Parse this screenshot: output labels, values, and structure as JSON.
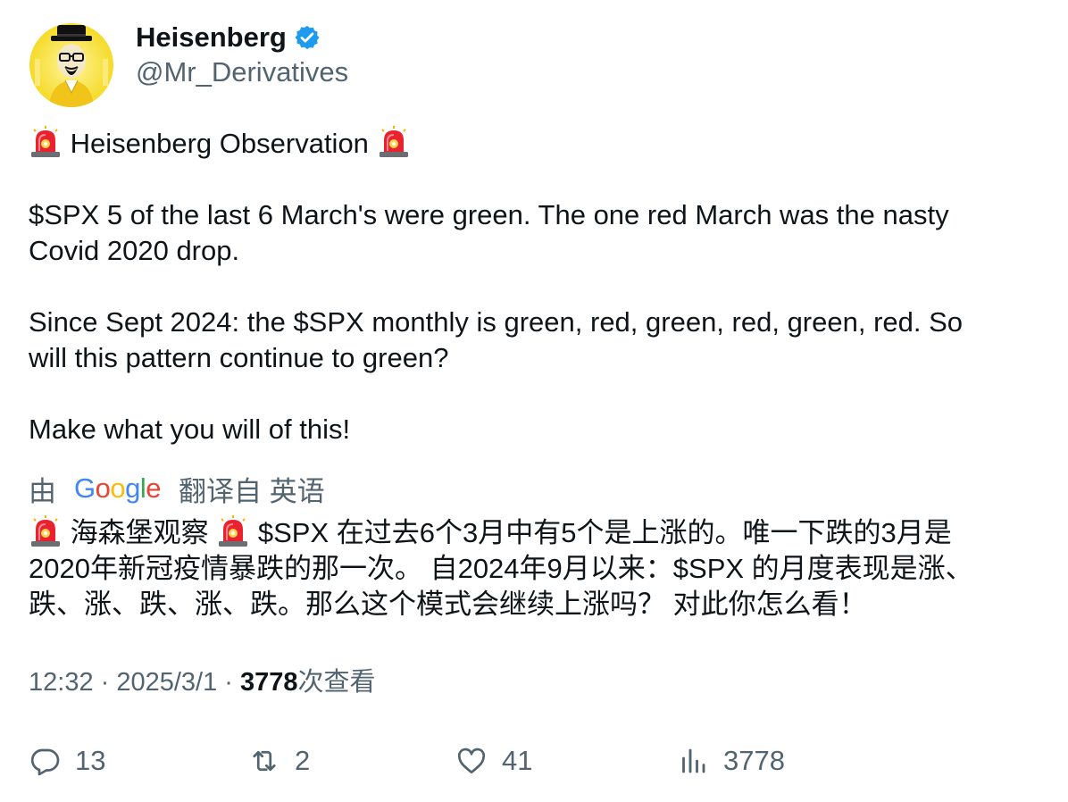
{
  "author": {
    "display_name": "Heisenberg",
    "handle": "@Mr_Derivatives",
    "verified": true,
    "verified_color": "#1d9bf0"
  },
  "tweet": {
    "line1": "Heisenberg Observation",
    "line2": "$SPX 5 of the last 6 March's were green. The one red March was the nasty",
    "line3": "Covid 2020 drop.",
    "line4": "Since Sept 2024: the $SPX monthly is green, red, green, red, green, red. So",
    "line5": "will this pattern continue to green?",
    "line6": "Make what you will of this!",
    "emoji": "siren-emoji"
  },
  "translation": {
    "by_label": "由",
    "provider": "Google",
    "from_label": "翻译自 英语",
    "line1_part1": "海森堡观察",
    "line1_part2": "$SPX 在过去6个3月中有5个是上涨的。唯一下跌的3月是",
    "line2": "2020年新冠疫情暴跌的那一次。 自2024年9月以来：$SPX 的月度表现是涨、",
    "line3": "跌、涨、跌、涨、跌。那么这个模式会继续上涨吗？ 对此你怎么看！"
  },
  "meta": {
    "time": "12:32",
    "separator": " · ",
    "date": "2025/3/1",
    "views_count": "3778",
    "views_label": "次查看"
  },
  "actions": {
    "replies": {
      "icon": "reply-icon",
      "count": "13"
    },
    "retweets": {
      "icon": "retweet-icon",
      "count": "2"
    },
    "likes": {
      "icon": "heart-icon",
      "count": "41"
    },
    "views": {
      "icon": "analytics-icon",
      "count": "3778"
    }
  },
  "colors": {
    "text": "#0f1419",
    "secondary": "#536471",
    "verified": "#1d9bf0",
    "avatar_bg": "#f7df3a",
    "siren_red": "#e8222e"
  }
}
